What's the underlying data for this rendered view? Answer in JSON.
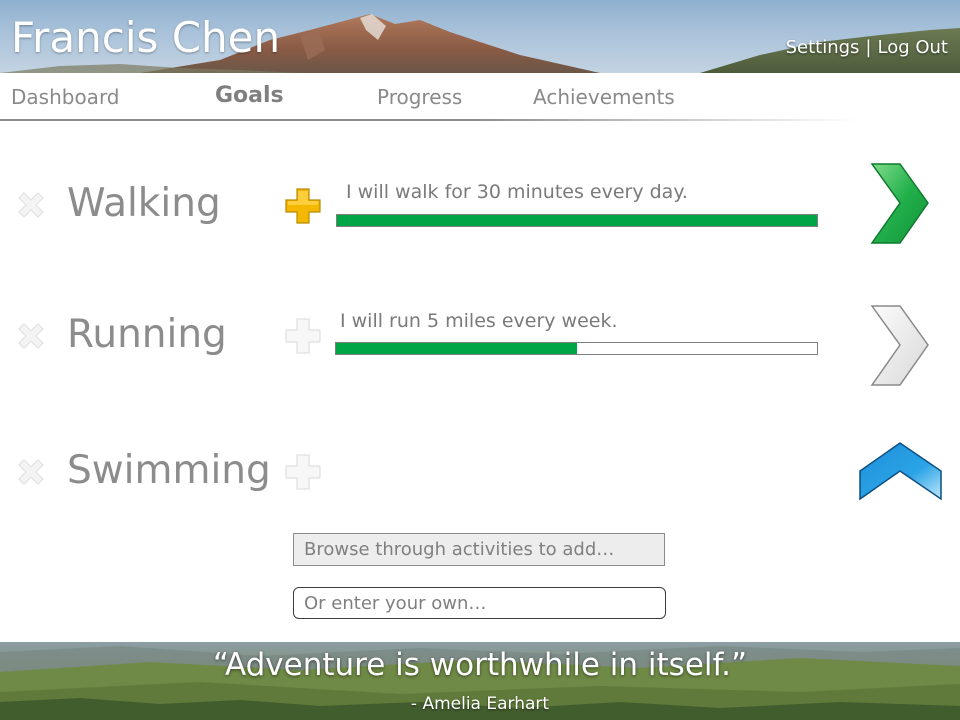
{
  "header": {
    "user_name": "Francis Chen",
    "settings_label": "Settings",
    "separator": "|",
    "logout_label": "Log Out"
  },
  "tabs": [
    {
      "label": "Dashboard",
      "active": false
    },
    {
      "label": "Goals",
      "active": true
    },
    {
      "label": "Progress",
      "active": false
    },
    {
      "label": "Achievements",
      "active": false
    }
  ],
  "goals": [
    {
      "activity": "Walking",
      "goal_text": "I will walk for 30 minutes every day.",
      "progress": 1.0,
      "add_icon": "plus-icon-highlighted",
      "arrow_icon": "chevron-right-icon",
      "arrow_color": "#22b04b"
    },
    {
      "activity": "Running",
      "goal_text": "I will run 5 miles every week.",
      "progress": 0.5,
      "add_icon": "plus-icon",
      "arrow_icon": "chevron-right-icon",
      "arrow_color": "#e0e0e0"
    },
    {
      "activity": "Swimming",
      "goal_text": "",
      "progress": null,
      "add_icon": "plus-icon",
      "arrow_icon": "chevron-up-icon",
      "arrow_color": "#2aa3e6"
    }
  ],
  "add_activity": {
    "browse_placeholder": "Browse through activities to add…",
    "own_placeholder": "Or enter your own…"
  },
  "footer": {
    "quote": "“Adventure is worthwhile in itself.”",
    "author": "- Amelia Earhart"
  },
  "colors": {
    "progress_fill": "#00a546",
    "plus_highlight": "#f5b800",
    "arrow_active": "#22b04b",
    "arrow_up": "#2aa3e6"
  }
}
